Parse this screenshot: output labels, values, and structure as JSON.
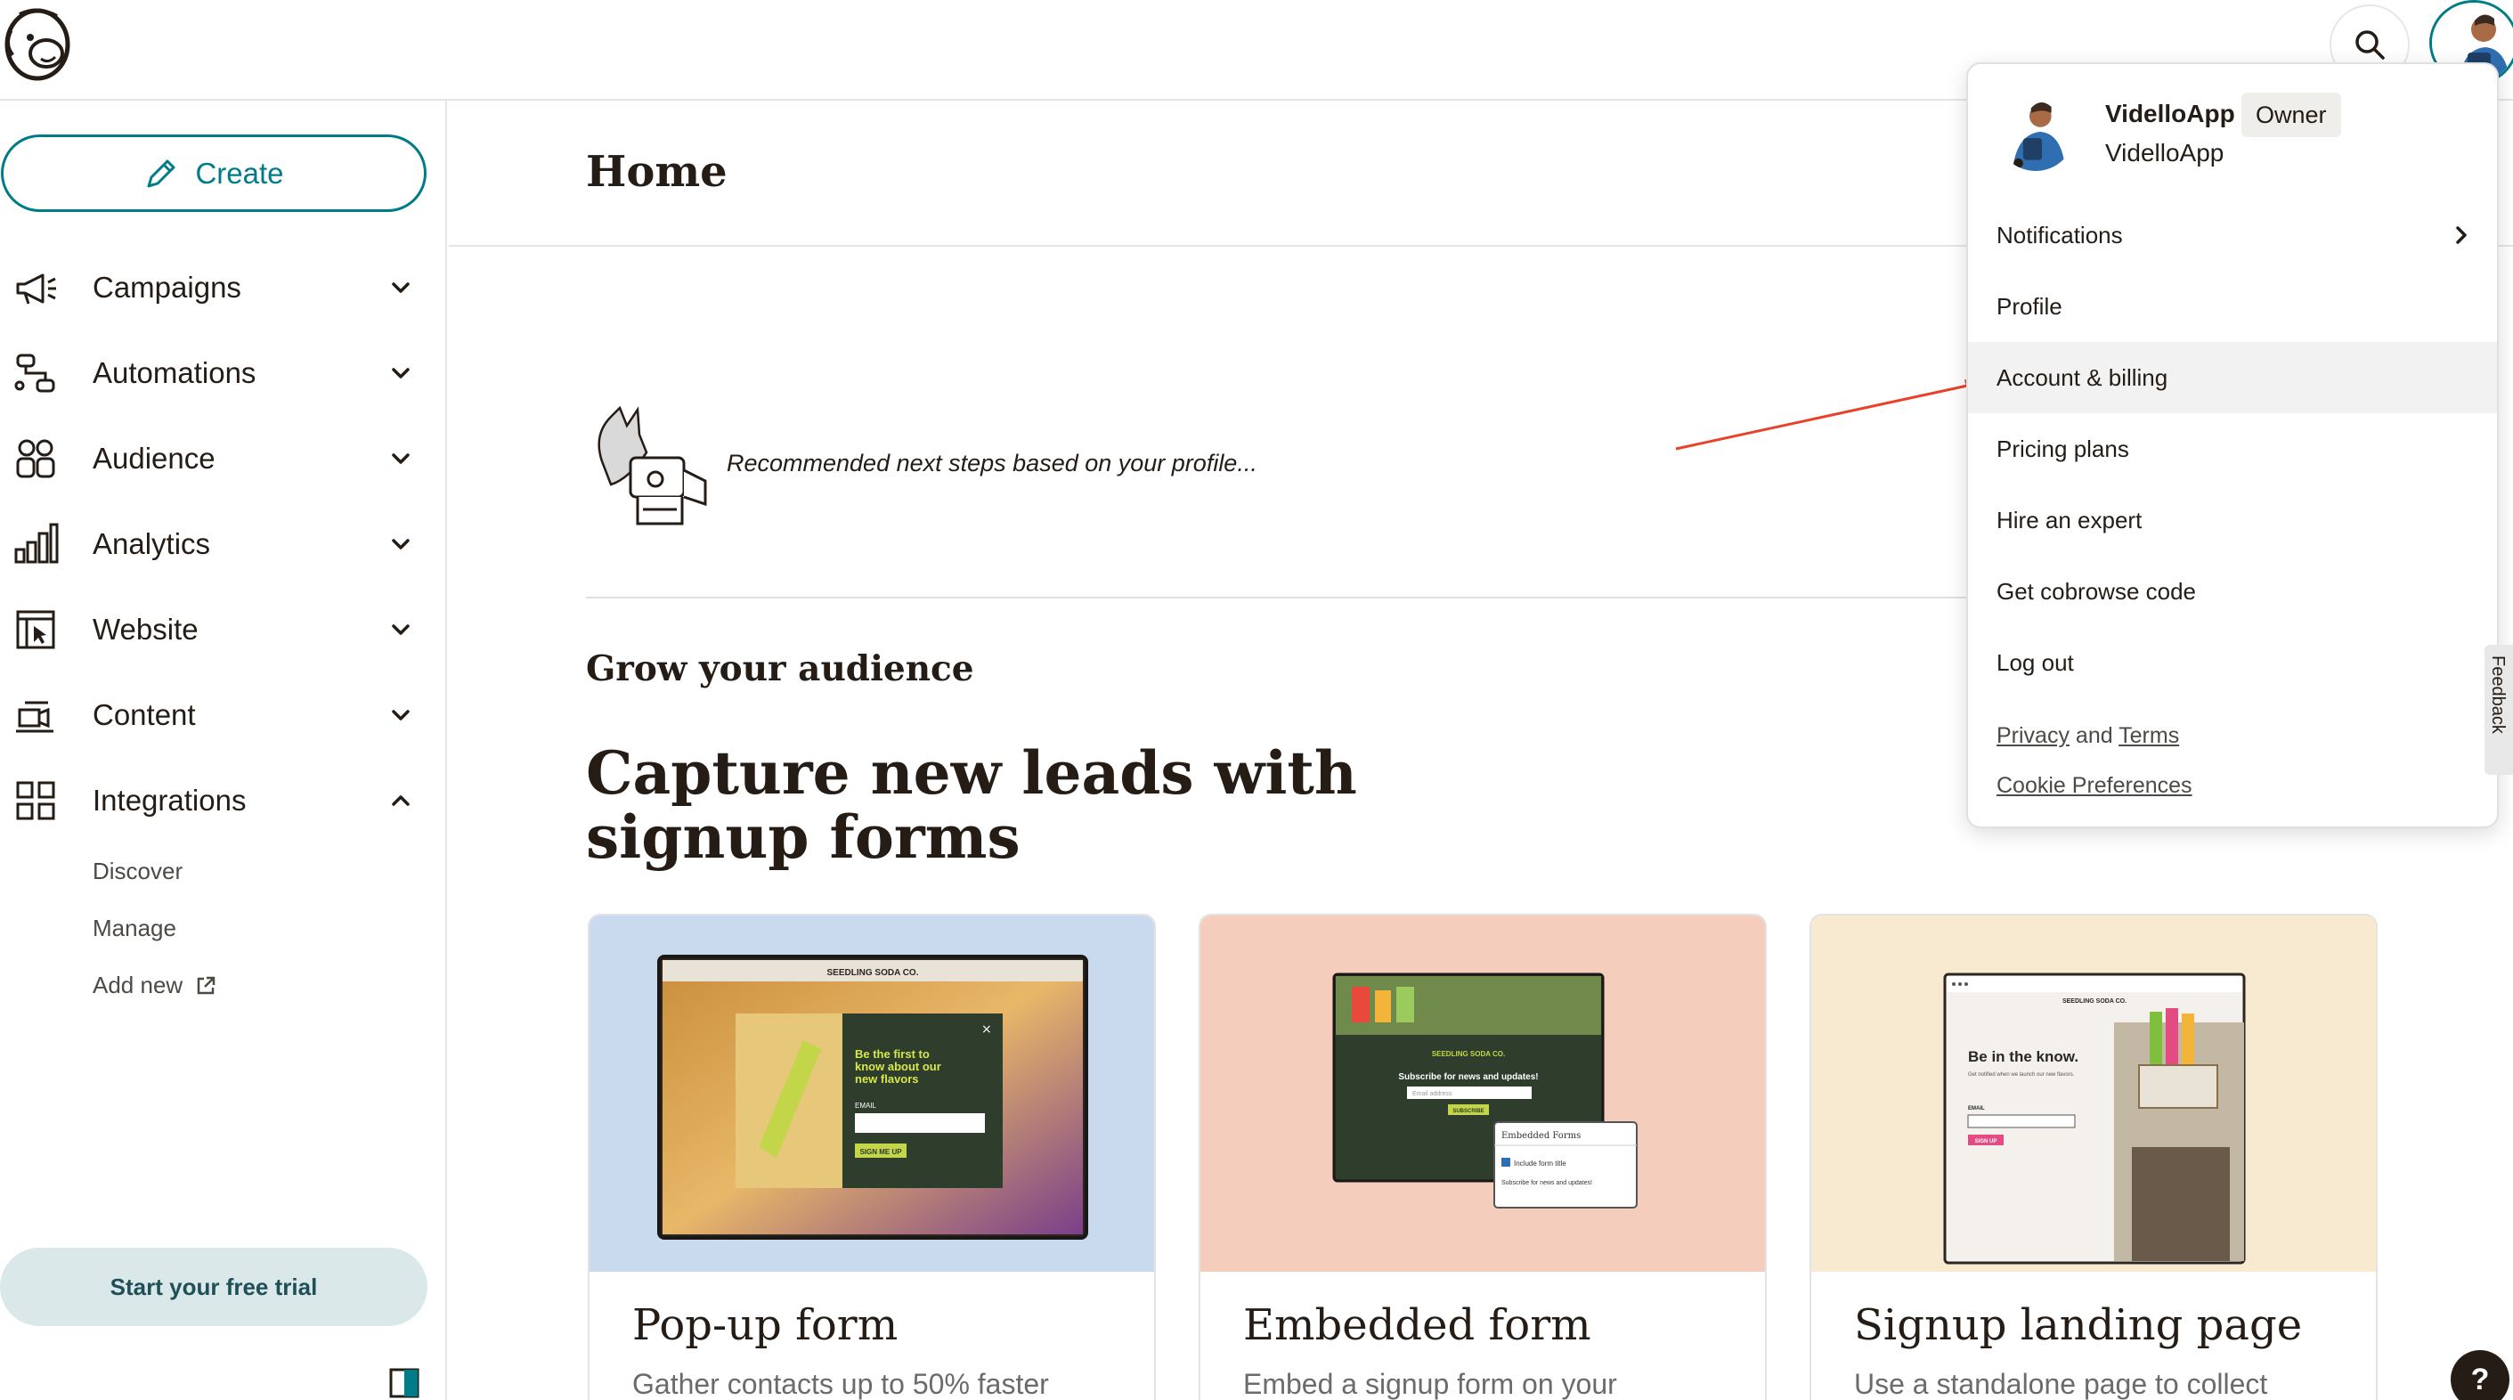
{
  "header": {
    "logo_icon": "mailchimp-freddie-logo-icon",
    "search_icon": "search-icon"
  },
  "sidebar": {
    "create_label": "Create",
    "items": [
      {
        "label": "Campaigns",
        "icon": "megaphone-icon",
        "expanded": false
      },
      {
        "label": "Automations",
        "icon": "automation-flow-icon",
        "expanded": false
      },
      {
        "label": "Audience",
        "icon": "audience-icon",
        "expanded": false
      },
      {
        "label": "Analytics",
        "icon": "bar-chart-icon",
        "expanded": false
      },
      {
        "label": "Website",
        "icon": "website-icon",
        "expanded": false
      },
      {
        "label": "Content",
        "icon": "content-icon",
        "expanded": false
      },
      {
        "label": "Integrations",
        "icon": "integrations-grid-icon",
        "expanded": true
      }
    ],
    "integrations_sub": [
      "Discover",
      "Manage",
      "Add new"
    ],
    "trial_label": "Start your free trial"
  },
  "main": {
    "title": "Home",
    "recommendation_text": "Recommended next steps based on your profile...",
    "section_label": "Grow your audience",
    "headline": "Capture new leads with signup forms",
    "cards": [
      {
        "title": "Pop-up form",
        "desc": "Gather contacts up to 50% faster",
        "bg": "#c9d9ee"
      },
      {
        "title": "Embedded form",
        "desc": "Embed a signup form on your",
        "bg": "#f5cdbd"
      },
      {
        "title": "Signup landing page",
        "desc": "Use a standalone page to collect",
        "bg": "#f7ead0"
      }
    ]
  },
  "mockups": {
    "brand": "SEEDLING SODA CO.",
    "popup_heading": "Be the first to know about our new flavors",
    "popup_email_label": "EMAIL",
    "popup_button": "SIGN ME UP",
    "embed_heading": "Subscribe for news and updates!",
    "embed_placeholder": "Email address",
    "embed_button": "SUBSCRIBE",
    "embed_panel_title": "Embedded Forms",
    "embed_panel_check": "Include form title",
    "embed_panel_sub": "Subscribe for news and updates!",
    "landing_heading": "Be in the know.",
    "landing_sub": "Get notified when we launch our new flavors.",
    "landing_email_label": "EMAIL",
    "landing_button": "SIGN UP"
  },
  "account_menu": {
    "name": "VidelloApp",
    "role": "Owner",
    "org": "VidelloApp",
    "items": [
      "Notifications",
      "Profile",
      "Account & billing",
      "Pricing plans",
      "Hire an expert",
      "Get cobrowse code",
      "Log out"
    ],
    "highlighted_item": "Account & billing",
    "privacy": "Privacy",
    "and": "and",
    "terms": "Terms",
    "cookie": "Cookie Preferences"
  },
  "feedback_label": "Feedback",
  "help_label": "?",
  "colors": {
    "accent": "#007c89",
    "text": "#241c15",
    "annotation_arrow": "#e8422a"
  }
}
